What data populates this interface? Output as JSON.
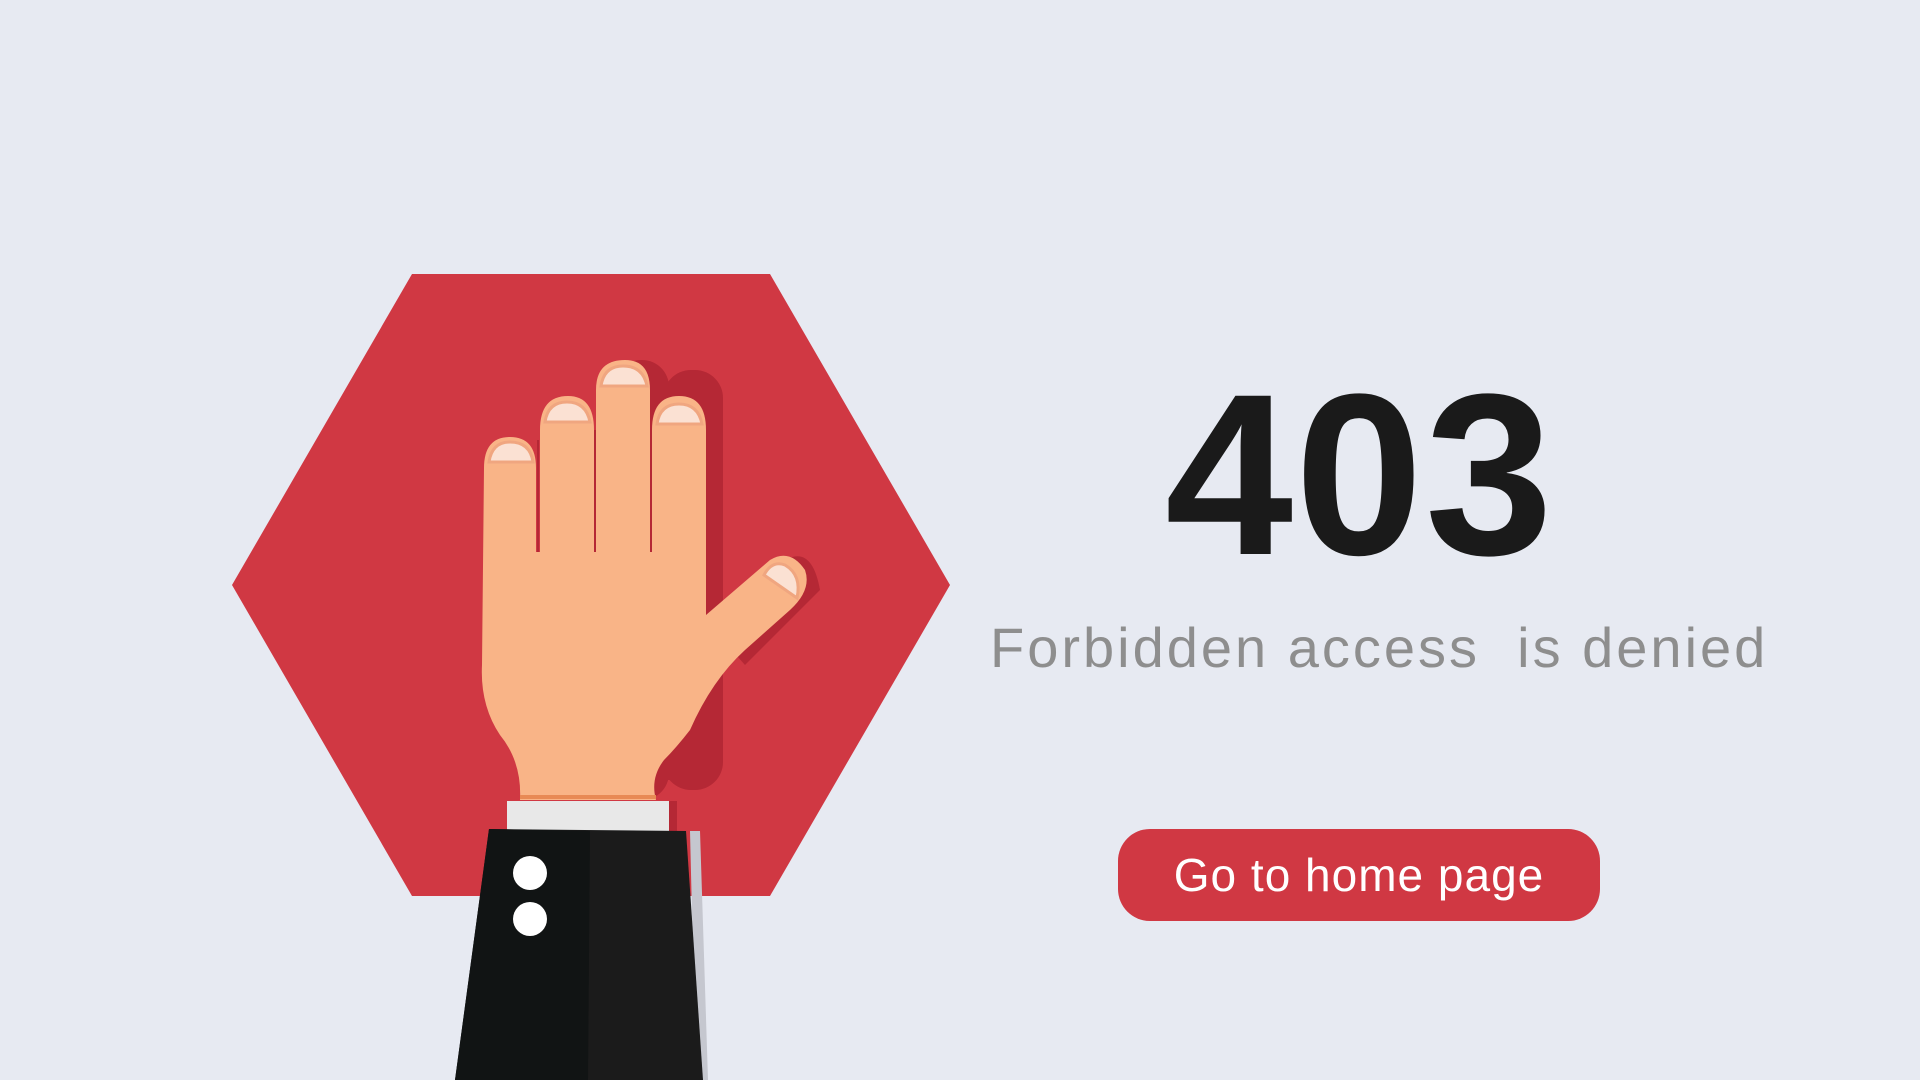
{
  "error": {
    "code": "403",
    "message": "Forbidden access  is denied"
  },
  "actions": {
    "home_button_label": "Go to home page"
  },
  "illustration": {
    "subject": "hand-stop-sign",
    "colors": {
      "background": "#E7EAF2",
      "stop_sign": "#D03843",
      "skin": "#F9B487",
      "sleeve": "#1A1A1A",
      "cuff": "#E8E8E8",
      "text_primary": "#1A1A1A",
      "text_secondary": "#8E8E8E",
      "button": "#D03843"
    }
  }
}
